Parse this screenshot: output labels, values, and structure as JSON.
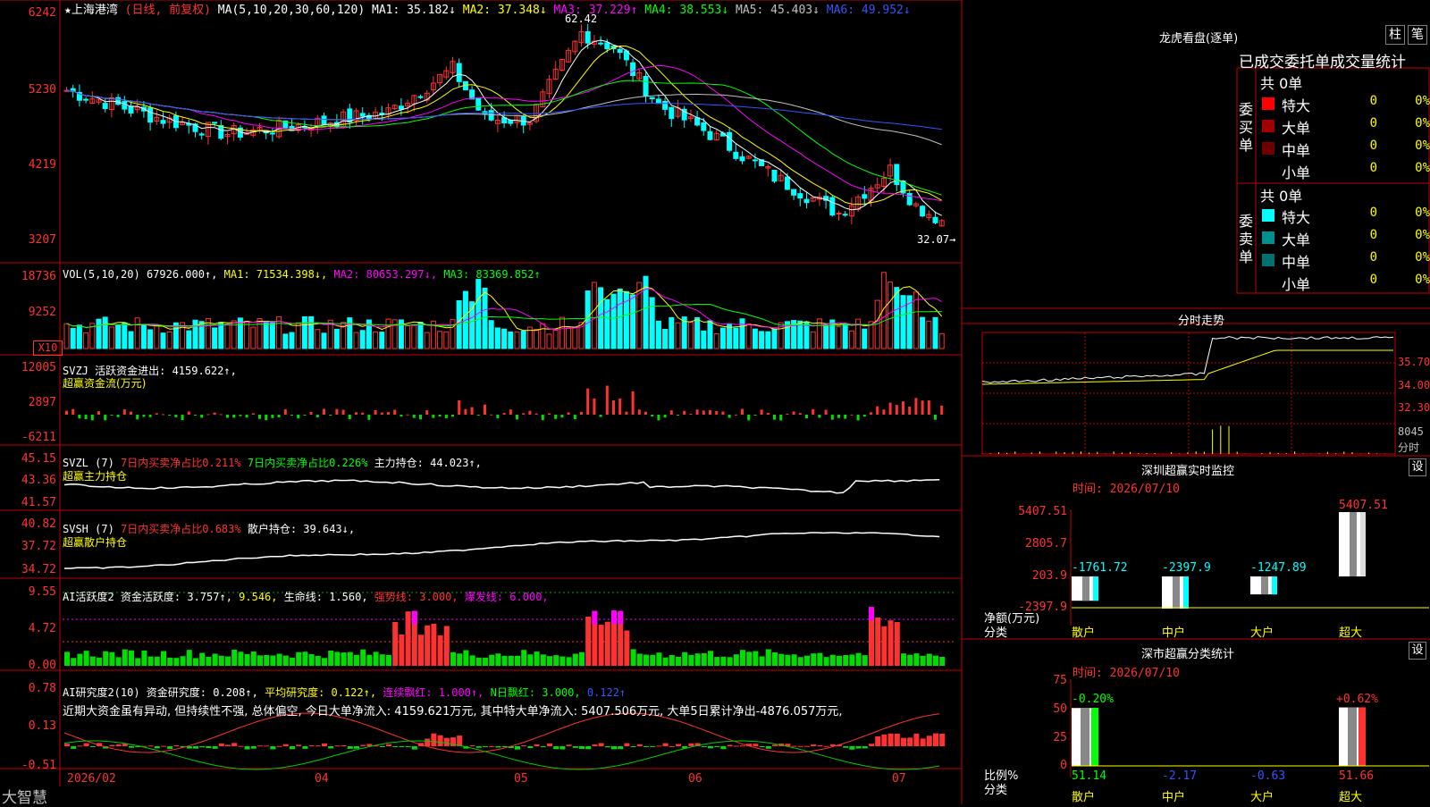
{
  "colors": {
    "up": "#ff3232",
    "down": "#00ffff",
    "bg": "#000000",
    "grid": "#c00000",
    "ma1": "#ffffff",
    "ma2": "#ffff00",
    "ma3": "#ff00ff",
    "ma4": "#00ff00",
    "ma5": "#c0c0c0",
    "ma6": "#3355ff",
    "vol_ma2": "#ff00ff",
    "vol_ma3": "#00ff00"
  },
  "price_panel": {
    "title": "★上海港湾",
    "mode": "(日线, 前复权)",
    "ma_prefix": "MA(5,10,20,30,60,120)",
    "ma_items": [
      {
        "label": "MA1: 35.182↓",
        "color": "#ffffff"
      },
      {
        "label": "MA2: 37.348↓",
        "color": "#ffff00"
      },
      {
        "label": "MA3: 37.229↑",
        "color": "#ff00ff"
      },
      {
        "label": "MA4: 38.553↓",
        "color": "#00ff00"
      },
      {
        "label": "MA5: 45.403↓",
        "color": "#c0c0c0"
      },
      {
        "label": "MA6: 49.952↓",
        "color": "#3355ff"
      }
    ],
    "high_marker": "62.42",
    "low_marker": "32.07→",
    "y_ticks": [
      "6242",
      "5230",
      "4219",
      "3207"
    ]
  },
  "volume_panel": {
    "header_name": "VOL(5,10,20)",
    "header_value": "67926.000↑,",
    "ma1": "MA1: 71534.398↓,",
    "ma2": "MA2: 80653.297↓,",
    "ma3": "MA3: 83369.852↑",
    "y_ticks": [
      "18736",
      "9252"
    ],
    "unit": "X10"
  },
  "svzj_panel": {
    "line1": "SVZJ  活跃资金进出: 4159.622↑,",
    "line2": "超赢资金流(万元)",
    "y_ticks": [
      "12005",
      "2897",
      "-6211"
    ]
  },
  "svzl_panel": {
    "prefix": "SVZL (7)",
    "red": "7日内买卖净占比0.211%",
    "green": "7日内买卖净占比0.226%",
    "white": "主力持仓: 44.023↑,",
    "line2": "超赢主力持仓",
    "y_ticks": [
      "45.15",
      "43.36",
      "41.57"
    ]
  },
  "svsh_panel": {
    "prefix": "SVSH (7)",
    "red": "7日内买卖净占比0.683%",
    "white": "散户持仓: 39.643↓,",
    "line2": "超赢散户持仓",
    "y_ticks": [
      "40.82",
      "37.72",
      "34.72"
    ]
  },
  "ai_active_panel": {
    "a": "AI活跃度2 资金活跃度: 3.757↑,",
    "b": "9.546,",
    "c": "生命线: 1.560,",
    "d": "强势线: 3.000,",
    "e": "爆发线: 6.000,",
    "y_ticks": [
      "9.55",
      "4.72",
      "0.00"
    ]
  },
  "ai_research_panel": {
    "a": "AI研究度2(10) 资金研究度: 0.208↑,",
    "b": "平均研究度: 0.122↑,",
    "c": "连续飘红: 1.000↑,",
    "d": "N日飘红: 3.000,",
    "e": "0.122↑",
    "comment": "近期大资金虽有异动, 但持续性不强, 总体偏空, 今日大单净流入: 4159.621万元, 其中特大单净流入: 5407.506万元, 大单5日累计净出-4876.057万元,",
    "y_ticks": [
      "0.78",
      "0.13",
      "-0.51"
    ]
  },
  "x_axis": {
    "labels": [
      "2026/02",
      "04",
      "05",
      "06",
      "07"
    ]
  },
  "brand": "大智慧",
  "right_panel": {
    "lhb_title": "龙虎看盘(逐单)",
    "tab_col": "柱",
    "tab_bi": "笔",
    "lhb_header": "已成交委托单成交量统计",
    "buy": {
      "side_label": "委买单",
      "total": "共 0单",
      "rows": [
        {
          "name": "特大",
          "count": "0",
          "pct": "0%",
          "color": "#ff0000"
        },
        {
          "name": "大单",
          "count": "0",
          "pct": "0%",
          "color": "#a00000"
        },
        {
          "name": "中单",
          "count": "0",
          "pct": "0%",
          "color": "#700000"
        },
        {
          "name": "小单",
          "count": "0",
          "pct": "0%",
          "color": ""
        }
      ]
    },
    "sell": {
      "side_label": "委卖单",
      "total": "共 0单",
      "rows": [
        {
          "name": "特大",
          "count": "0",
          "pct": "0%",
          "color": "#00ffff"
        },
        {
          "name": "大单",
          "count": "0",
          "pct": "0%",
          "color": "#009090"
        },
        {
          "name": "中单",
          "count": "0",
          "pct": "0%",
          "color": "#007070"
        },
        {
          "name": "小单",
          "count": "0",
          "pct": "0%",
          "color": ""
        }
      ]
    },
    "intraday": {
      "title": "分时走势",
      "y_labels": [
        "35.70",
        "34.00",
        "32.30"
      ],
      "vol_label": "8045",
      "unit": "分时"
    },
    "sz_monitor": {
      "title": "深圳超赢实时监控",
      "settings": "设",
      "date": "时间: 2026/07/10",
      "y_labels": [
        "5407.51",
        "2805.7",
        "203.9",
        "-2397.9"
      ],
      "unit": "净额(万元)",
      "cat_label": "分类",
      "cats": [
        "散户",
        "中户",
        "大户",
        "超大"
      ]
    },
    "sz_category": {
      "title": "深市超赢分类统计",
      "settings": "设",
      "date": "时间: 2026/07/10",
      "y_labels": [
        "75",
        "50",
        "25",
        "0"
      ],
      "unit": "比例%",
      "cat_label": "分类",
      "cats": [
        "散户",
        "中户",
        "大户",
        "超大"
      ]
    }
  },
  "chart_data": [
    {
      "type": "bar",
      "title": "深圳超赢实时监控",
      "ylabel": "净额(万元)",
      "categories": [
        "散户",
        "中户",
        "大户",
        "超大"
      ],
      "values": [
        -1761.72,
        -2397.9,
        -1247.89,
        5407.51
      ],
      "ylim": [
        -2397.9,
        5407.51
      ]
    },
    {
      "type": "bar",
      "title": "深市超赢分类统计",
      "ylabel": "比例%",
      "categories": [
        "散户",
        "中户",
        "大户",
        "超大"
      ],
      "series": [
        {
          "values": [
            51.14,
            -2.17,
            -0.63,
            51.66
          ]
        },
        {
          "values": [
            -0.2,
            null,
            null,
            0.62
          ]
        }
      ],
      "ylim": [
        0,
        75
      ]
    }
  ]
}
